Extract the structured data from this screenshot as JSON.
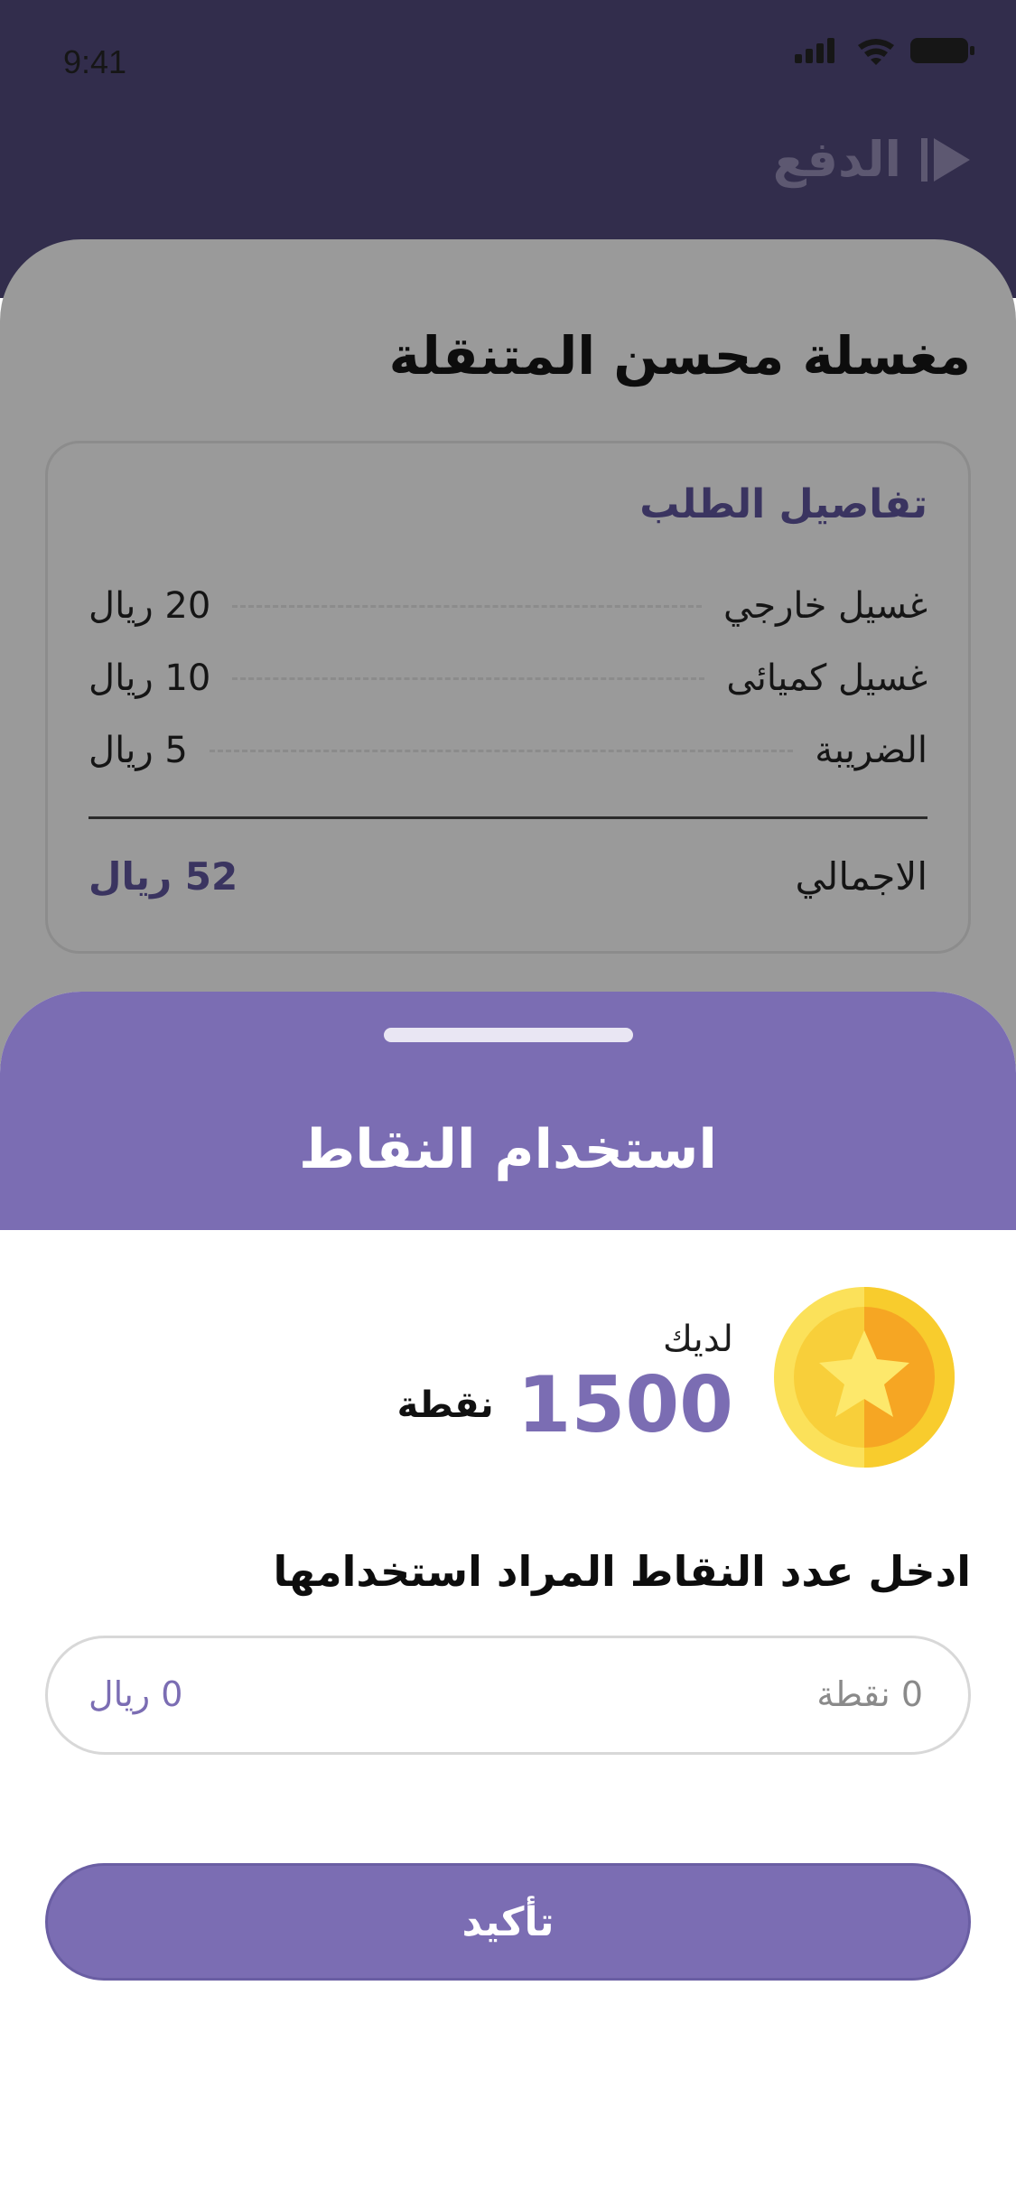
{
  "status_bar": {
    "time": "9:41"
  },
  "nav": {
    "title": "الدفع"
  },
  "page": {
    "title": "مغسلة محسن المتنقلة"
  },
  "order_details": {
    "title": "تفاصيل الطلب",
    "items": [
      {
        "label": "غسيل خارجي",
        "price": "20 ريال"
      },
      {
        "label": "غسيل كميائى",
        "price": "10 ريال"
      },
      {
        "label": "الضريبة",
        "price": "5 ريال"
      }
    ],
    "total_label": "الاجمالي",
    "total_value": "52 ريال"
  },
  "sheet": {
    "title": "استخدام النقاط",
    "have_label": "لديك",
    "points_value": "1500",
    "points_unit": "نقطة",
    "enter_label": "ادخل عدد النقاط المراد استخدامها",
    "input_points_placeholder": "0 نقطة",
    "input_riyal_value": "0 ريال",
    "confirm_label": "تأكيد"
  },
  "colors": {
    "accent": "#7b6db3",
    "header": "#322d4c",
    "coin_outer": "#fbe15a",
    "coin_inner": "#f6a623"
  },
  "icons": [
    "signal-icon",
    "wifi-icon",
    "battery-icon",
    "play-icon",
    "star-coin-icon"
  ]
}
